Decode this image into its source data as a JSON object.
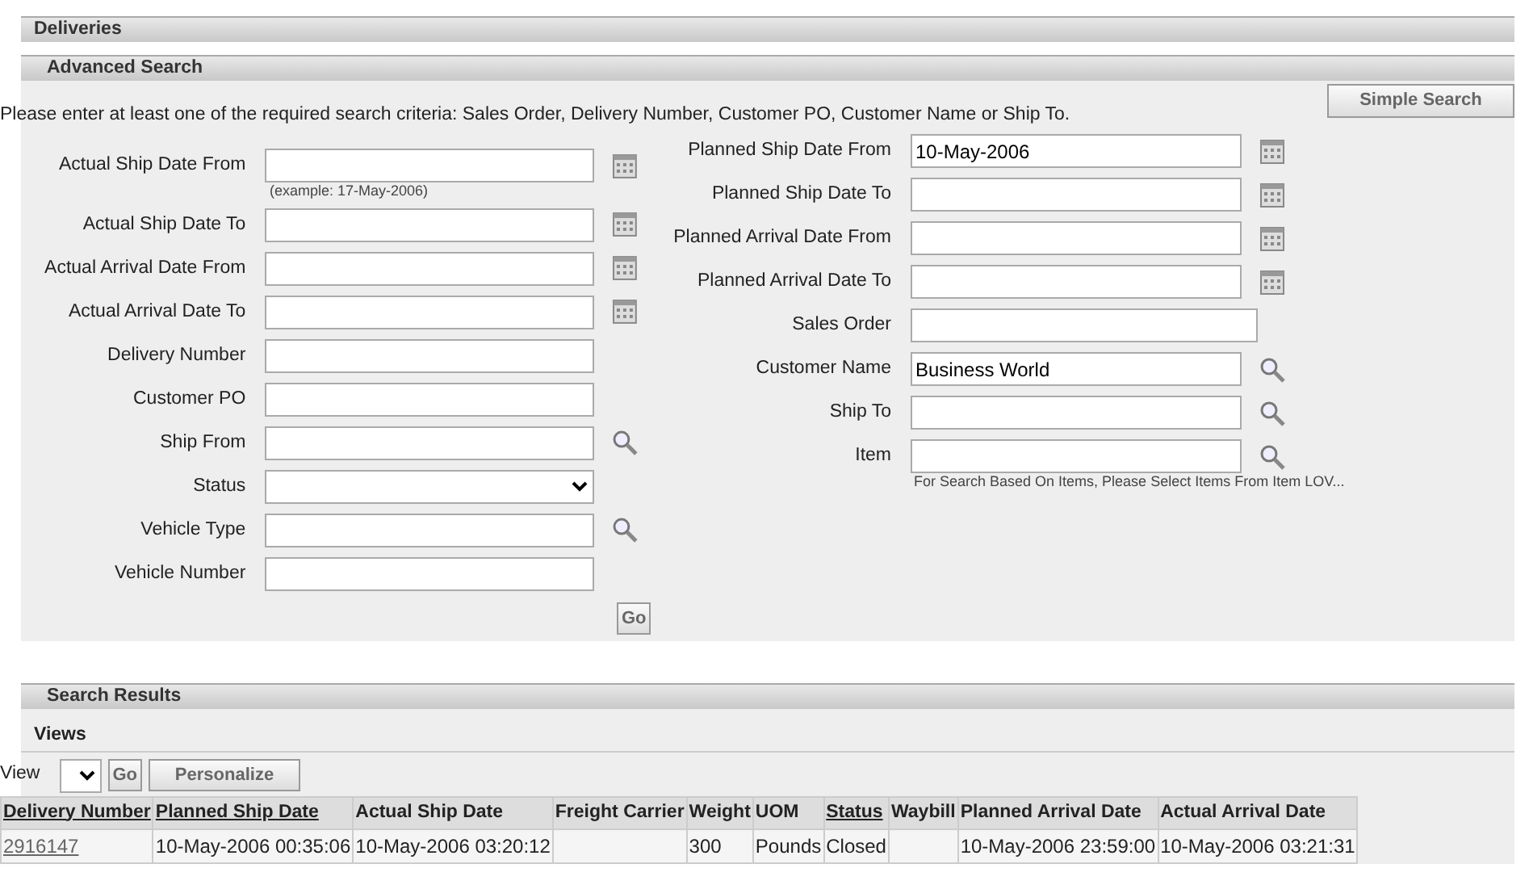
{
  "page_title": "Deliveries",
  "advanced_search": {
    "title": "Advanced Search",
    "instruction": "Please enter at least one of the required search criteria: Sales Order, Delivery Number, Customer PO, Customer Name or Ship To.",
    "simple_search_button": "Simple Search",
    "left_fields": [
      {
        "label": "Actual Ship Date From",
        "kind": "date",
        "hint": "(example: 17-May-2006)"
      },
      {
        "label": "Actual Ship Date To",
        "kind": "date"
      },
      {
        "label": "Actual Arrival Date From",
        "kind": "date"
      },
      {
        "label": "Actual Arrival Date To",
        "kind": "date"
      },
      {
        "label": "Delivery Number",
        "kind": "text"
      },
      {
        "label": "Customer PO",
        "kind": "text"
      },
      {
        "label": "Ship From",
        "kind": "lookup"
      },
      {
        "label": "Status",
        "kind": "select"
      },
      {
        "label": "Vehicle Type",
        "kind": "lookup"
      },
      {
        "label": "Vehicle Number",
        "kind": "text"
      }
    ],
    "go_button": "Go",
    "right_fields": [
      {
        "label": "Planned Ship Date From",
        "kind": "date",
        "value": "10-May-2006"
      },
      {
        "label": "Planned Ship Date To",
        "kind": "date"
      },
      {
        "label": "Planned Arrival Date From",
        "kind": "date"
      },
      {
        "label": "Planned Arrival Date To",
        "kind": "date"
      },
      {
        "label": "Sales Order",
        "kind": "wide"
      },
      {
        "label": "Customer Name",
        "kind": "lookup",
        "value": "Business World"
      },
      {
        "label": "Ship To",
        "kind": "lookup"
      },
      {
        "label": "Item",
        "kind": "lookup",
        "hint": "For Search Based On Items, Please Select Items From Item LOV..."
      }
    ]
  },
  "search_results": {
    "title": "Search Results",
    "views_title": "Views",
    "view_label": "View",
    "go_button": "Go",
    "personalize_button": "Personalize",
    "table": {
      "columns": [
        {
          "label": "Delivery Number",
          "kind": "link"
        },
        {
          "label": "Planned Ship Date",
          "kind": "sortable"
        },
        {
          "label": "Actual Ship Date",
          "kind": "plain"
        },
        {
          "label": "Freight Carrier",
          "kind": "plain"
        },
        {
          "label": "Weight",
          "kind": "plain"
        },
        {
          "label": "UOM",
          "kind": "plain"
        },
        {
          "label": "Status",
          "kind": "sortable"
        },
        {
          "label": "Waybill",
          "kind": "plain"
        },
        {
          "label": "Planned Arrival Date",
          "kind": "plain"
        },
        {
          "label": "Actual Arrival Date",
          "kind": "plain"
        }
      ],
      "rows": [
        [
          "2916147",
          "10-May-2006 00:35:06",
          "10-May-2006 03:20:12",
          null,
          "300",
          "Pounds",
          "Closed",
          null,
          "10-May-2006 23:59:00",
          "10-May-2006 03:21:31"
        ]
      ]
    }
  }
}
